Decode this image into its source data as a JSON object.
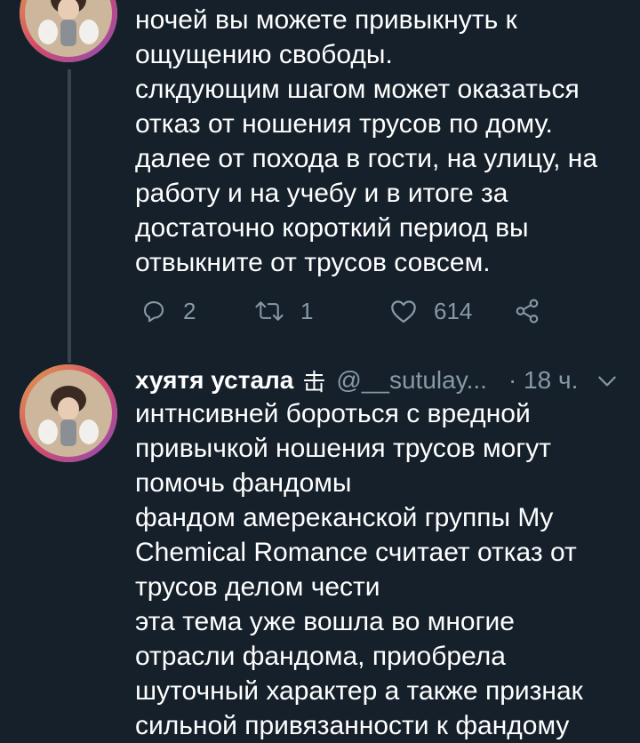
{
  "tweet_top": {
    "text_lines": [
      "ночей вы можете привыкнуть к",
      "ощущению свободы.",
      "слкдующим шагом может оказаться",
      "отказ от ношения трусов по дому.",
      "далее от похода в гости, на улицу, на",
      "работу и на учебу и в итоге за",
      "достаточно короткий период вы",
      "отвыкните от трусов совсем."
    ],
    "actions": {
      "reply_icon": "reply-icon",
      "reply_count": "2",
      "retweet_icon": "retweet-icon",
      "retweet_count": "1",
      "like_icon": "heart-icon",
      "like_count": "614",
      "share_icon": "share-icon"
    }
  },
  "tweet_bottom": {
    "author": {
      "display_name": "хуятя устала",
      "name_glyph": "击",
      "handle": "@__sutulay...",
      "time": "· 18 ч."
    },
    "menu_icon": "chevron-down-icon",
    "text_lines": [
      "интнсивней бороться с вредной",
      "привычкой ношения трусов могут",
      "помочь фандомы",
      "фандом амереканской группы My",
      "Chemical Romance считает отказ от",
      "трусов делом чести",
      "эта тема уже вошла во многие",
      "отрасли фандома, приобрела",
      "шуточный характер а также признак",
      "сильной привязанности к фандому"
    ]
  },
  "colors": {
    "background": "#15202b",
    "text": "#ffffff",
    "secondary_text": "#8899a6",
    "thread_line": "#38444d"
  }
}
